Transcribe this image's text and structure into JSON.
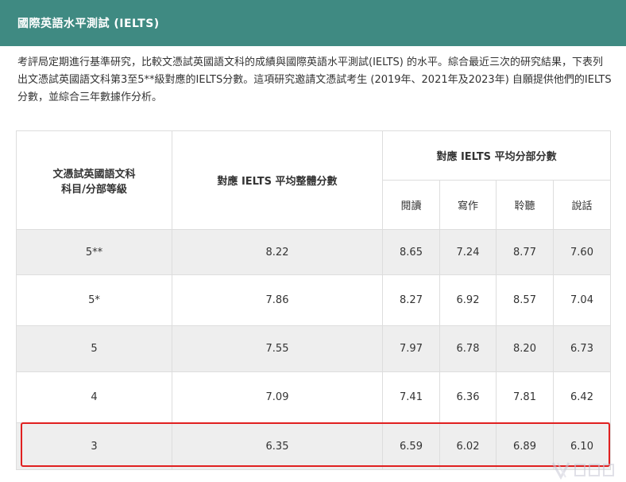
{
  "header": {
    "title": "國際英語水平測試 (IELTS)"
  },
  "intro": {
    "text": "考評局定期進行基準研究，比較文憑試英國語文科的成績與國際英語水平測試(IELTS) 的水平。綜合最近三次的研究結果，下表列出文憑試英國語文科第3至5**級對應的IELTS分數。這項研究邀請文憑試考生 (2019年、2021年及2023年) 自願提供他們的IELTS分數，並綜合三年數據作分析。"
  },
  "table": {
    "col1_header_line1": "文憑試英國語文科",
    "col1_header_line2": "科目/分部等級",
    "col2_header": "對應 IELTS 平均整體分數",
    "group_header": "對應 IELTS 平均分部分數",
    "sub_headers": [
      "閱讀",
      "寫作",
      "聆聽",
      "說話"
    ],
    "rows": [
      {
        "level": "5**",
        "overall": "8.22",
        "reading": "8.65",
        "writing": "7.24",
        "listening": "8.77",
        "speaking": "7.60"
      },
      {
        "level": "5*",
        "overall": "7.86",
        "reading": "8.27",
        "writing": "6.92",
        "listening": "8.57",
        "speaking": "7.04"
      },
      {
        "level": "5",
        "overall": "7.55",
        "reading": "7.97",
        "writing": "6.78",
        "listening": "8.20",
        "speaking": "6.73"
      },
      {
        "level": "4",
        "overall": "7.09",
        "reading": "7.41",
        "writing": "6.36",
        "listening": "7.81",
        "speaking": "6.42"
      },
      {
        "level": "3",
        "overall": "6.35",
        "reading": "6.59",
        "writing": "6.02",
        "listening": "6.89",
        "speaking": "6.10"
      }
    ]
  },
  "colors": {
    "header_bg": "#3f8a82",
    "shaded_row": "#eeeeee",
    "highlight": "#e02020"
  },
  "watermark": {
    "icon": "logo-watermark-icon"
  }
}
